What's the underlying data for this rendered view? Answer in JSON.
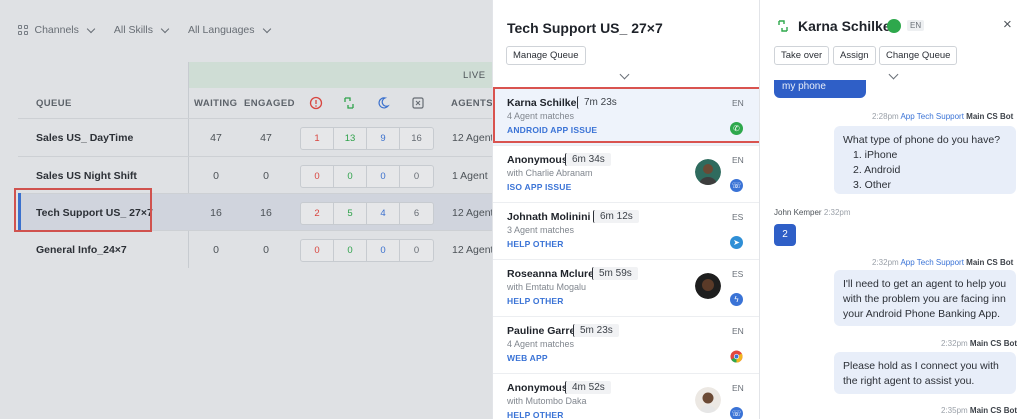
{
  "filters": {
    "channels": "Channels",
    "skills": "All Skills",
    "languages": "All Languages"
  },
  "table": {
    "live_label": "LIVE",
    "headers": {
      "queue": "QUEUE",
      "waiting": "WAITING",
      "engaged": "ENGAGED",
      "agents": "AGENTS"
    },
    "rows": [
      {
        "name": "Sales US_ DayTime",
        "waiting": "47",
        "engaged": "47",
        "c1": "1",
        "c2": "13",
        "c3": "9",
        "c4": "16",
        "agents": "12 Agents"
      },
      {
        "name": "Sales US Night Shift",
        "waiting": "0",
        "engaged": "0",
        "c1": "0",
        "c2": "0",
        "c3": "0",
        "c4": "0",
        "agents": "1 Agent"
      },
      {
        "name": "Tech Support US_ 27×7",
        "waiting": "16",
        "engaged": "16",
        "c1": "2",
        "c2": "5",
        "c3": "4",
        "c4": "6",
        "agents": "12 Agents"
      },
      {
        "name": "General Info_24×7",
        "waiting": "0",
        "engaged": "0",
        "c1": "0",
        "c2": "0",
        "c3": "0",
        "c4": "0",
        "agents": "12 Agents"
      }
    ]
  },
  "queue_panel": {
    "title": "Tech Support US_ 27×7",
    "manage_label": "Manage Queue",
    "conversations": [
      {
        "name": "Karna Schilke",
        "time": "7m 23s",
        "sub": "4 Agent matches",
        "tags": "ANDROID   APP ISSUE",
        "lang": "EN",
        "channel": "whatsapp"
      },
      {
        "name": "Anonymous",
        "time": "6m 34s",
        "sub": "with Charlie Abranam",
        "tags": "ISO   APP ISSUE",
        "lang": "EN",
        "channel": "phone"
      },
      {
        "name": "Johnath Molinini",
        "time": "6m 12s",
        "sub": "3 Agent matches",
        "tags": "HELP OTHER",
        "lang": "ES",
        "channel": "telegram"
      },
      {
        "name": "Roseanna Mclure",
        "time": "5m 59s",
        "sub": "with Emtatu Mogalu",
        "tags": "HELP OTHER",
        "lang": "ES",
        "channel": "messenger"
      },
      {
        "name": "Pauline Garre",
        "time": "5m 23s",
        "sub": "4 Agent matches",
        "tags": "WEB APP",
        "lang": "EN",
        "channel": "chrome"
      },
      {
        "name": "Anonymous",
        "time": "4m 52s",
        "sub": "with Mutombo Daka",
        "tags": "HELP OTHER",
        "lang": "EN",
        "channel": "phone"
      }
    ]
  },
  "chat": {
    "contact_name": "Karna Schilke",
    "lang": "EN",
    "close": "×",
    "actions": {
      "take_over": "Take over",
      "assign": "Assign",
      "change_queue": "Change Queue"
    },
    "prev_bubble": "my phone",
    "messages": [
      {
        "time": "2:28pm",
        "source": "App Tech Support",
        "bot": "Main CS Bot",
        "lines": [
          "What type of phone do you have?",
          "1. iPhone",
          "2. Android",
          "3. Other"
        ]
      },
      {
        "user_name": "John Kemper",
        "user_time": "2:32pm",
        "reply": "2"
      },
      {
        "time": "2:32pm",
        "source": "App Tech Support",
        "bot": "Main CS Bot",
        "lines": [
          "I'll need to get an agent to help you",
          "with the problem you are facing inn",
          "your Android Phone Banking App."
        ]
      },
      {
        "time": "2:32pm",
        "bot": "Main CS Bot",
        "lines": [
          "Please hold as I connect you with",
          "the right agent to assist you."
        ]
      },
      {
        "time": "2:35pm",
        "bot": "Main CS Bot"
      }
    ]
  },
  "colors": {
    "accent": "#3a73d6",
    "highlight_border": "#d9534f",
    "whatsapp": "#2ea84c"
  }
}
